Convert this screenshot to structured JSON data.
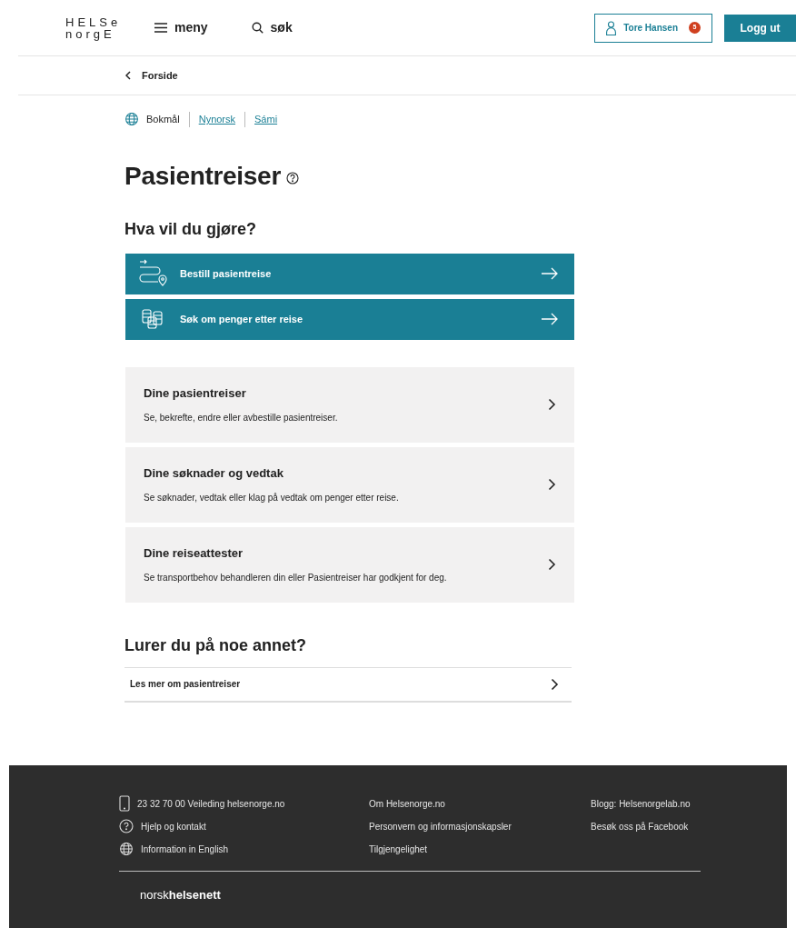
{
  "header": {
    "logo_lines": [
      "**HELS**e",
      "norg**E**"
    ],
    "menu": "meny",
    "search": "søk",
    "user": {
      "name": "Tore Hansen",
      "badge": "5"
    },
    "logout": "Logg ut"
  },
  "breadcrumb": {
    "label": "Forside"
  },
  "languages": [
    {
      "label": "Bokmål",
      "selected": true
    },
    {
      "label": "Nynorsk",
      "selected": false
    },
    {
      "label": "Sámi",
      "selected": false
    }
  ],
  "title": "Pasientreiser",
  "section_heading": "Hva vil du gjøre?",
  "actions": [
    {
      "kind": "route",
      "label": "Bestill pasientreise"
    },
    {
      "kind": "coins",
      "label": "Søk om penger etter reise"
    }
  ],
  "cards": [
    {
      "title": "Dine pasientreiser",
      "text": "Se, bekrefte, endre eller avbestille pasientreiser."
    },
    {
      "title": "Dine søknader og vedtak",
      "text": "Se søknader, vedtak eller klag på vedtak om penger etter reise."
    },
    {
      "title": "Dine reiseattester",
      "text": "Se transportbehov behandleren din eller Pasientreiser har godkjent for deg."
    }
  ],
  "more_heading": "Lurer du på noe annet?",
  "more_links": [
    "Les mer om pasientreiser"
  ],
  "footer": {
    "columns": [
      [
        {
          "kind": "phone",
          "label": "23 32 70 00 Veileding helsenorge.no"
        },
        {
          "kind": "help",
          "label": "Hjelp og kontakt"
        },
        {
          "kind": "globe",
          "label": "Information in English"
        }
      ],
      [
        {
          "label": "Om Helsenorge.no"
        },
        {
          "label": "Personvern og informasjonskapsler"
        },
        {
          "label": "Tilgjengelighet"
        }
      ],
      [
        {
          "label": "Blogg: Helsenorgelab.no"
        },
        {
          "label": "Besøk oss på Facebook"
        }
      ]
    ],
    "brand": "norsk**helsenett**"
  }
}
